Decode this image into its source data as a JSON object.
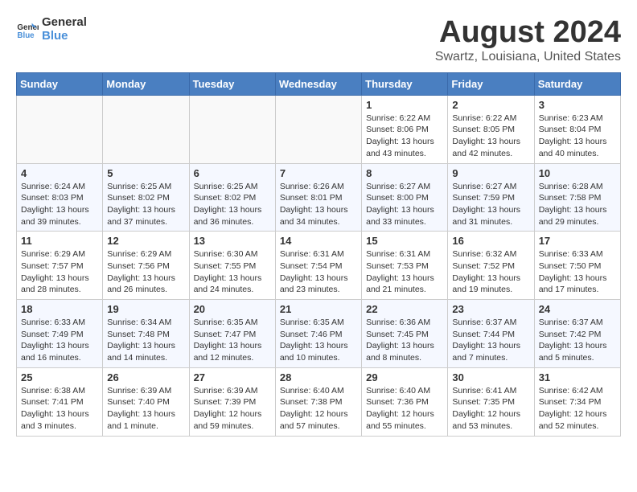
{
  "header": {
    "logo_line1": "General",
    "logo_line2": "Blue",
    "month": "August 2024",
    "location": "Swartz, Louisiana, United States"
  },
  "days_of_week": [
    "Sunday",
    "Monday",
    "Tuesday",
    "Wednesday",
    "Thursday",
    "Friday",
    "Saturday"
  ],
  "weeks": [
    [
      {
        "day": "",
        "info": ""
      },
      {
        "day": "",
        "info": ""
      },
      {
        "day": "",
        "info": ""
      },
      {
        "day": "",
        "info": ""
      },
      {
        "day": "1",
        "info": "Sunrise: 6:22 AM\nSunset: 8:06 PM\nDaylight: 13 hours\nand 43 minutes."
      },
      {
        "day": "2",
        "info": "Sunrise: 6:22 AM\nSunset: 8:05 PM\nDaylight: 13 hours\nand 42 minutes."
      },
      {
        "day": "3",
        "info": "Sunrise: 6:23 AM\nSunset: 8:04 PM\nDaylight: 13 hours\nand 40 minutes."
      }
    ],
    [
      {
        "day": "4",
        "info": "Sunrise: 6:24 AM\nSunset: 8:03 PM\nDaylight: 13 hours\nand 39 minutes."
      },
      {
        "day": "5",
        "info": "Sunrise: 6:25 AM\nSunset: 8:02 PM\nDaylight: 13 hours\nand 37 minutes."
      },
      {
        "day": "6",
        "info": "Sunrise: 6:25 AM\nSunset: 8:02 PM\nDaylight: 13 hours\nand 36 minutes."
      },
      {
        "day": "7",
        "info": "Sunrise: 6:26 AM\nSunset: 8:01 PM\nDaylight: 13 hours\nand 34 minutes."
      },
      {
        "day": "8",
        "info": "Sunrise: 6:27 AM\nSunset: 8:00 PM\nDaylight: 13 hours\nand 33 minutes."
      },
      {
        "day": "9",
        "info": "Sunrise: 6:27 AM\nSunset: 7:59 PM\nDaylight: 13 hours\nand 31 minutes."
      },
      {
        "day": "10",
        "info": "Sunrise: 6:28 AM\nSunset: 7:58 PM\nDaylight: 13 hours\nand 29 minutes."
      }
    ],
    [
      {
        "day": "11",
        "info": "Sunrise: 6:29 AM\nSunset: 7:57 PM\nDaylight: 13 hours\nand 28 minutes."
      },
      {
        "day": "12",
        "info": "Sunrise: 6:29 AM\nSunset: 7:56 PM\nDaylight: 13 hours\nand 26 minutes."
      },
      {
        "day": "13",
        "info": "Sunrise: 6:30 AM\nSunset: 7:55 PM\nDaylight: 13 hours\nand 24 minutes."
      },
      {
        "day": "14",
        "info": "Sunrise: 6:31 AM\nSunset: 7:54 PM\nDaylight: 13 hours\nand 23 minutes."
      },
      {
        "day": "15",
        "info": "Sunrise: 6:31 AM\nSunset: 7:53 PM\nDaylight: 13 hours\nand 21 minutes."
      },
      {
        "day": "16",
        "info": "Sunrise: 6:32 AM\nSunset: 7:52 PM\nDaylight: 13 hours\nand 19 minutes."
      },
      {
        "day": "17",
        "info": "Sunrise: 6:33 AM\nSunset: 7:50 PM\nDaylight: 13 hours\nand 17 minutes."
      }
    ],
    [
      {
        "day": "18",
        "info": "Sunrise: 6:33 AM\nSunset: 7:49 PM\nDaylight: 13 hours\nand 16 minutes."
      },
      {
        "day": "19",
        "info": "Sunrise: 6:34 AM\nSunset: 7:48 PM\nDaylight: 13 hours\nand 14 minutes."
      },
      {
        "day": "20",
        "info": "Sunrise: 6:35 AM\nSunset: 7:47 PM\nDaylight: 13 hours\nand 12 minutes."
      },
      {
        "day": "21",
        "info": "Sunrise: 6:35 AM\nSunset: 7:46 PM\nDaylight: 13 hours\nand 10 minutes."
      },
      {
        "day": "22",
        "info": "Sunrise: 6:36 AM\nSunset: 7:45 PM\nDaylight: 13 hours\nand 8 minutes."
      },
      {
        "day": "23",
        "info": "Sunrise: 6:37 AM\nSunset: 7:44 PM\nDaylight: 13 hours\nand 7 minutes."
      },
      {
        "day": "24",
        "info": "Sunrise: 6:37 AM\nSunset: 7:42 PM\nDaylight: 13 hours\nand 5 minutes."
      }
    ],
    [
      {
        "day": "25",
        "info": "Sunrise: 6:38 AM\nSunset: 7:41 PM\nDaylight: 13 hours\nand 3 minutes."
      },
      {
        "day": "26",
        "info": "Sunrise: 6:39 AM\nSunset: 7:40 PM\nDaylight: 13 hours\nand 1 minute."
      },
      {
        "day": "27",
        "info": "Sunrise: 6:39 AM\nSunset: 7:39 PM\nDaylight: 12 hours\nand 59 minutes."
      },
      {
        "day": "28",
        "info": "Sunrise: 6:40 AM\nSunset: 7:38 PM\nDaylight: 12 hours\nand 57 minutes."
      },
      {
        "day": "29",
        "info": "Sunrise: 6:40 AM\nSunset: 7:36 PM\nDaylight: 12 hours\nand 55 minutes."
      },
      {
        "day": "30",
        "info": "Sunrise: 6:41 AM\nSunset: 7:35 PM\nDaylight: 12 hours\nand 53 minutes."
      },
      {
        "day": "31",
        "info": "Sunrise: 6:42 AM\nSunset: 7:34 PM\nDaylight: 12 hours\nand 52 minutes."
      }
    ]
  ]
}
